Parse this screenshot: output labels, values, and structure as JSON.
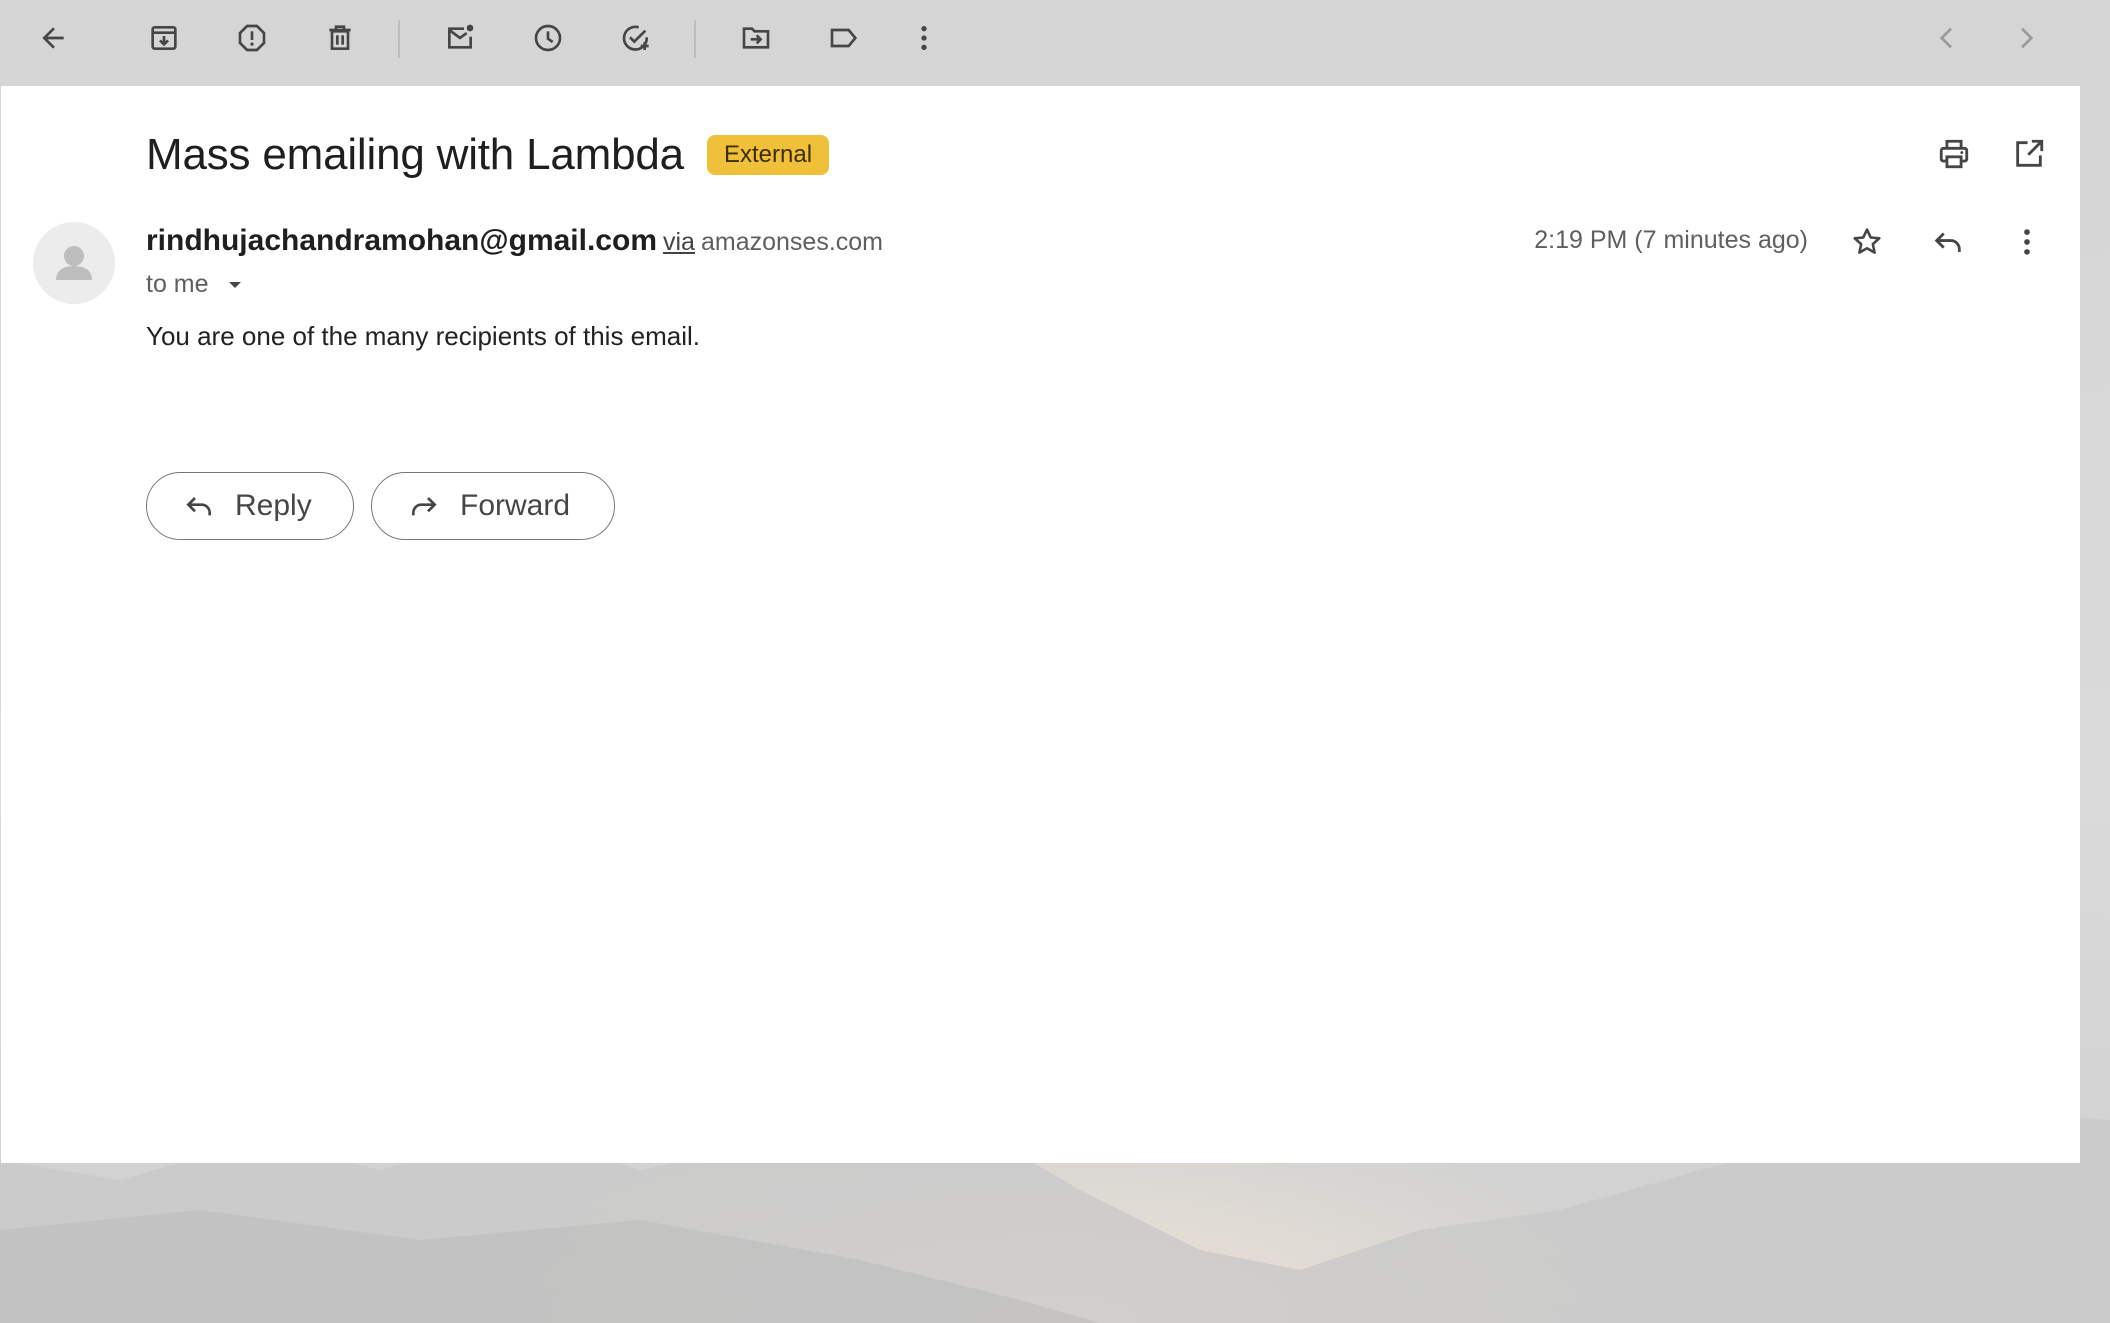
{
  "toolbar": {
    "left_icons": [
      "back-arrow-icon",
      "archive-icon",
      "report-spam-icon",
      "delete-icon",
      "mark-unread-icon",
      "snooze-icon",
      "add-to-tasks-icon",
      "move-to-icon",
      "label-icon",
      "more-vert-icon"
    ],
    "right_icons": [
      "chevron-left-icon",
      "chevron-right-icon"
    ]
  },
  "email": {
    "subject": "Mass emailing with Lambda",
    "badge": "External",
    "sender_email": "rindhujachandramohan@gmail.com",
    "via_label": "via",
    "via_domain": "amazonses.com",
    "recipient": "to me",
    "timestamp": "2:19 PM (7 minutes ago)",
    "body": "You are one of the many recipients of this email."
  },
  "actions": {
    "reply_label": "Reply",
    "forward_label": "Forward"
  },
  "colors": {
    "badge_bg": "#f0c03b",
    "panel_bg": "#ffffff",
    "icon": "#444746"
  }
}
